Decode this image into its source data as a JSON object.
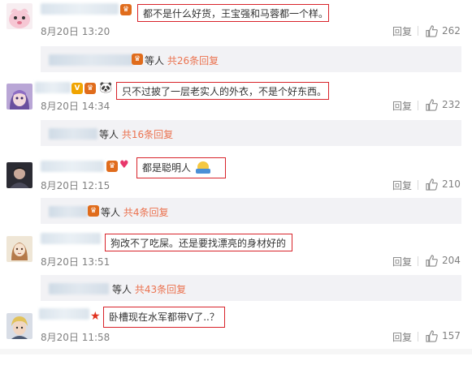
{
  "comments": [
    {
      "text": "都不是什么好货，王宝强和马蓉都一个样。",
      "date": "8月20日 13:20",
      "reply_label": "回复",
      "likes": "262",
      "sub_prefix": "等人",
      "sub_link": "共26条回复",
      "avatar_icon": "pink-character-avatar-icon"
    },
    {
      "text": "只不过披了一层老实人的外衣，不是个好东西。",
      "date": "8月20日 14:34",
      "reply_label": "回复",
      "likes": "232",
      "sub_prefix": "等人",
      "sub_link": "共16条回复",
      "avatar_icon": "anime-girl-avatar-icon",
      "badges": [
        "v-badge-icon",
        "crown-badge-icon",
        "panda-icon"
      ]
    },
    {
      "text": "都是聪明人",
      "date": "8月20日 12:15",
      "reply_label": "回复",
      "likes": "210",
      "sub_prefix": "等人",
      "sub_link": "共4条回复",
      "avatar_icon": "dark-portrait-avatar-icon",
      "emoji": "shrug-emoji-icon",
      "badges": [
        "crown-badge-icon",
        "heart-badge-icon"
      ]
    },
    {
      "text": "狗改不了吃屎。还是要找漂亮的身材好的",
      "date": "8月20日 13:51",
      "reply_label": "回复",
      "likes": "204",
      "sub_prefix": "等人",
      "sub_link": "共43条回复",
      "avatar_icon": "sketch-girl-avatar-icon"
    },
    {
      "text": "卧槽现在水军都带V了..？",
      "date": "8月20日 11:58",
      "reply_label": "回复",
      "likes": "157",
      "avatar_icon": "blonde-man-avatar-icon",
      "badges": [
        "star-badge-icon"
      ]
    }
  ],
  "colors": {
    "highlight_border": "#d8232a",
    "link": "#eb7350",
    "meta_gray": "#808080",
    "sub_bg": "#f2f2f5"
  }
}
